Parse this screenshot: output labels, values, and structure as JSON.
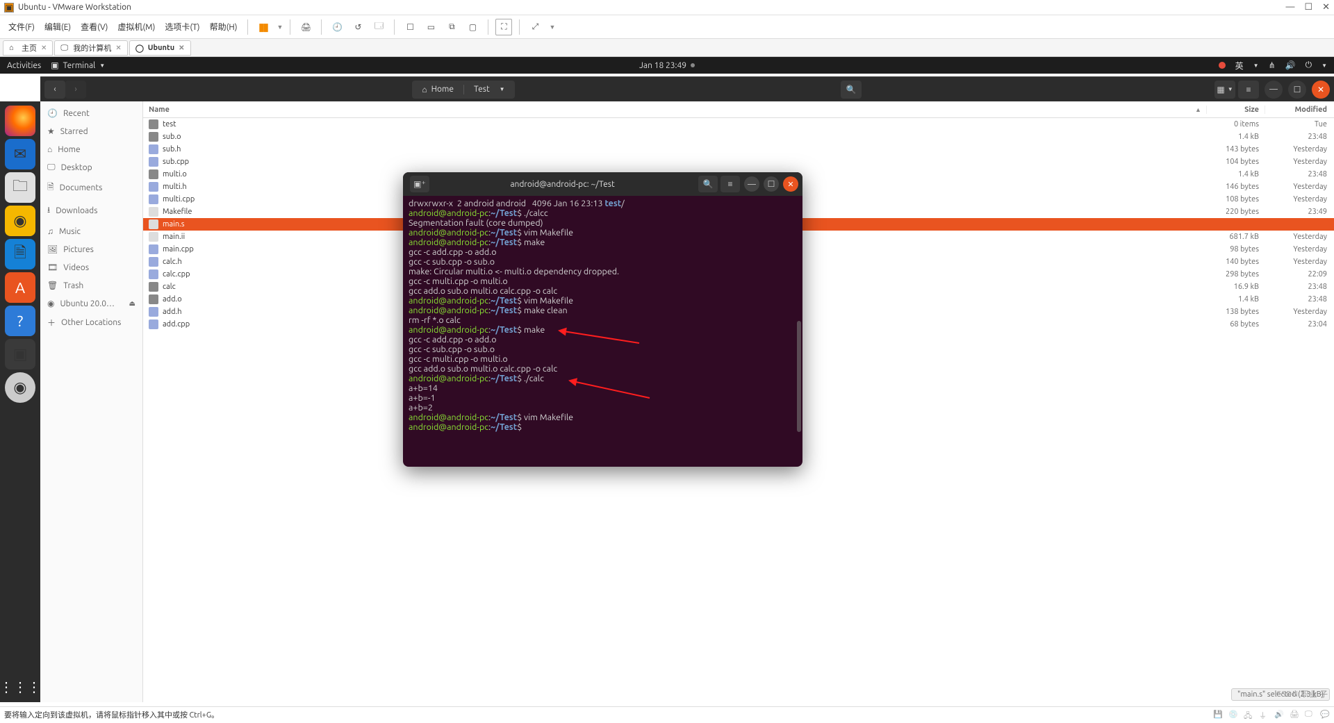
{
  "vmware": {
    "title": "Ubuntu - VMware Workstation",
    "menu": [
      "文件(F)",
      "编辑(E)",
      "查看(V)",
      "虚拟机(M)",
      "选项卡(T)",
      "帮助(H)"
    ],
    "tabs": [
      {
        "label": "主页",
        "active": false
      },
      {
        "label": "我的计算机",
        "active": false
      },
      {
        "label": "Ubuntu",
        "active": true
      }
    ],
    "status_left": "要将输入定向到该虚拟机，请将鼠标指针移入其中或按 Ctrl+G。"
  },
  "ubuntu_topbar": {
    "activities": "Activities",
    "app": "Terminal",
    "datetime": "Jan 18  23:49",
    "ime": "英"
  },
  "nautilus": {
    "path": {
      "home": "Home",
      "seg": "Test"
    },
    "columns": {
      "name": "Name",
      "size": "Size",
      "modified": "Modified"
    },
    "sidebar": [
      {
        "icon": "🕘",
        "label": "Recent"
      },
      {
        "icon": "★",
        "label": "Starred"
      },
      {
        "icon": "⌂",
        "label": "Home"
      },
      {
        "icon": "🖵",
        "label": "Desktop"
      },
      {
        "icon": "🗎",
        "label": "Documents"
      },
      {
        "icon": "⭳",
        "label": "Downloads"
      },
      {
        "icon": "♫",
        "label": "Music"
      },
      {
        "icon": "🖼",
        "label": "Pictures"
      },
      {
        "icon": "🎞",
        "label": "Videos"
      },
      {
        "icon": "🗑",
        "label": "Trash"
      },
      {
        "icon": "◉",
        "label": "Ubuntu 20.0…"
      },
      {
        "icon": "＋",
        "label": "Other Locations"
      }
    ],
    "files": [
      {
        "icon": "folder",
        "name": "test",
        "size": "0 items",
        "mod": "Tue",
        "sel": false
      },
      {
        "icon": "o",
        "name": "sub.o",
        "size": "1.4 kB",
        "mod": "23:48",
        "sel": false
      },
      {
        "icon": "h",
        "name": "sub.h",
        "size": "143 bytes",
        "mod": "Yesterday",
        "sel": false
      },
      {
        "icon": "cpp",
        "name": "sub.cpp",
        "size": "104 bytes",
        "mod": "Yesterday",
        "sel": false
      },
      {
        "icon": "o",
        "name": "multi.o",
        "size": "1.4 kB",
        "mod": "23:48",
        "sel": false
      },
      {
        "icon": "h",
        "name": "multi.h",
        "size": "146 bytes",
        "mod": "Yesterday",
        "sel": false
      },
      {
        "icon": "cpp",
        "name": "multi.cpp",
        "size": "108 bytes",
        "mod": "Yesterday",
        "sel": false
      },
      {
        "icon": "txt",
        "name": "Makefile",
        "size": "220 bytes",
        "mod": "23:49",
        "sel": false
      },
      {
        "icon": "txt",
        "name": "main.s",
        "size": "",
        "mod": "",
        "sel": true
      },
      {
        "icon": "txt",
        "name": "main.ii",
        "size": "681.7 kB",
        "mod": "Yesterday",
        "sel": false
      },
      {
        "icon": "cpp",
        "name": "main.cpp",
        "size": "98 bytes",
        "mod": "Yesterday",
        "sel": false
      },
      {
        "icon": "h",
        "name": "calc.h",
        "size": "140 bytes",
        "mod": "Yesterday",
        "sel": false
      },
      {
        "icon": "cpp",
        "name": "calc.cpp",
        "size": "298 bytes",
        "mod": "22:09",
        "sel": false
      },
      {
        "icon": "bin",
        "name": "calc",
        "size": "16.9 kB",
        "mod": "23:48",
        "sel": false
      },
      {
        "icon": "o",
        "name": "add.o",
        "size": "1.4 kB",
        "mod": "23:48",
        "sel": false
      },
      {
        "icon": "h",
        "name": "add.h",
        "size": "138 bytes",
        "mod": "Yesterday",
        "sel": false
      },
      {
        "icon": "cpp",
        "name": "add.cpp",
        "size": "68 bytes",
        "mod": "23:04",
        "sel": false
      }
    ],
    "status": "\"main.s\" selected  (2.3 kB)"
  },
  "terminal": {
    "title": "android@android-pc: ~/Test",
    "lines": [
      [
        {
          "c": "tw",
          "t": "drwxrwxr-x  2 android android   4096 Jan 16 23:13 "
        },
        {
          "c": "tb",
          "t": "test"
        },
        {
          "c": "tw",
          "t": "/"
        }
      ],
      [
        {
          "c": "tg",
          "t": "android@android-pc"
        },
        {
          "c": "tw",
          "t": ":"
        },
        {
          "c": "tb",
          "t": "~/Test"
        },
        {
          "c": "tw",
          "t": "$ ./calcc"
        }
      ],
      [
        {
          "c": "tw",
          "t": "Segmentation fault (core dumped)"
        }
      ],
      [
        {
          "c": "tg",
          "t": "android@android-pc"
        },
        {
          "c": "tw",
          "t": ":"
        },
        {
          "c": "tb",
          "t": "~/Test"
        },
        {
          "c": "tw",
          "t": "$ vim Makefile"
        }
      ],
      [
        {
          "c": "tg",
          "t": "android@android-pc"
        },
        {
          "c": "tw",
          "t": ":"
        },
        {
          "c": "tb",
          "t": "~/Test"
        },
        {
          "c": "tw",
          "t": "$ make"
        }
      ],
      [
        {
          "c": "tw",
          "t": "gcc -c add.cpp -o add.o"
        }
      ],
      [
        {
          "c": "tw",
          "t": "gcc -c sub.cpp -o sub.o"
        }
      ],
      [
        {
          "c": "tw",
          "t": "make: Circular multi.o <- multi.o dependency dropped."
        }
      ],
      [
        {
          "c": "tw",
          "t": "gcc -c multi.cpp -o multi.o"
        }
      ],
      [
        {
          "c": "tw",
          "t": "gcc add.o sub.o multi.o calc.cpp -o calc"
        }
      ],
      [
        {
          "c": "tg",
          "t": "android@android-pc"
        },
        {
          "c": "tw",
          "t": ":"
        },
        {
          "c": "tb",
          "t": "~/Test"
        },
        {
          "c": "tw",
          "t": "$ vim Makefile"
        }
      ],
      [
        {
          "c": "tg",
          "t": "android@android-pc"
        },
        {
          "c": "tw",
          "t": ":"
        },
        {
          "c": "tb",
          "t": "~/Test"
        },
        {
          "c": "tw",
          "t": "$ make clean"
        }
      ],
      [
        {
          "c": "tw",
          "t": "rm -rf *.o calc"
        }
      ],
      [
        {
          "c": "tg",
          "t": "android@android-pc"
        },
        {
          "c": "tw",
          "t": ":"
        },
        {
          "c": "tb",
          "t": "~/Test"
        },
        {
          "c": "tw",
          "t": "$ make"
        }
      ],
      [
        {
          "c": "tw",
          "t": "gcc -c add.cpp -o add.o"
        }
      ],
      [
        {
          "c": "tw",
          "t": "gcc -c sub.cpp -o sub.o"
        }
      ],
      [
        {
          "c": "tw",
          "t": "gcc -c multi.cpp -o multi.o"
        }
      ],
      [
        {
          "c": "tw",
          "t": "gcc add.o sub.o multi.o calc.cpp -o calc"
        }
      ],
      [
        {
          "c": "tg",
          "t": "android@android-pc"
        },
        {
          "c": "tw",
          "t": ":"
        },
        {
          "c": "tb",
          "t": "~/Test"
        },
        {
          "c": "tw",
          "t": "$ ./calc"
        }
      ],
      [
        {
          "c": "tw",
          "t": "a+b=14"
        }
      ],
      [
        {
          "c": "tw",
          "t": "a+b=-1"
        }
      ],
      [
        {
          "c": "tw",
          "t": "a+b=2"
        }
      ],
      [
        {
          "c": "tg",
          "t": "android@android-pc"
        },
        {
          "c": "tw",
          "t": ":"
        },
        {
          "c": "tb",
          "t": "~/Test"
        },
        {
          "c": "tw",
          "t": "$ vim Makefile"
        }
      ],
      [
        {
          "c": "tg",
          "t": "android@android-pc"
        },
        {
          "c": "tw",
          "t": ":"
        },
        {
          "c": "tb",
          "t": "~/Test"
        },
        {
          "c": "tw",
          "t": "$ "
        }
      ]
    ]
  },
  "watermark": "CSDN 职业 子"
}
